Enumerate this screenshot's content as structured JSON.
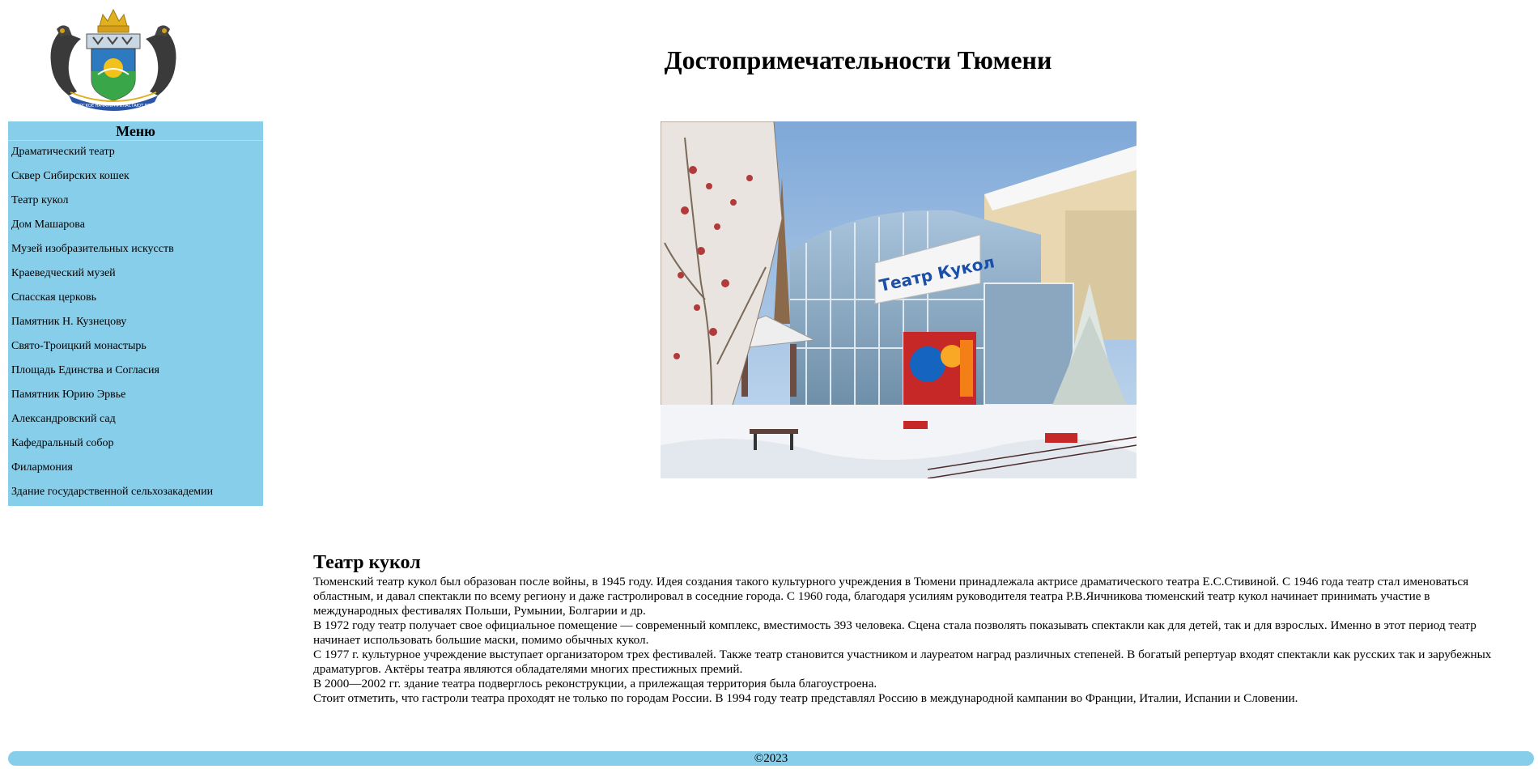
{
  "header": {
    "title": "Достопримечательности Тюмени",
    "logo_icon": "tyumen-coat-of-arms-icon",
    "logo_ribbon_text": "СИБИРСКОЕ НАЧАЛО ПРИЛАСТАЮТ ВЕДЕТ"
  },
  "sidebar": {
    "title": "Меню",
    "background": "#87ceeb",
    "items": [
      {
        "label": "Драматический театр"
      },
      {
        "label": "Сквер Сибирских кошек"
      },
      {
        "label": "Театр кукол"
      },
      {
        "label": "Дом Машарова"
      },
      {
        "label": "Музей изобразительных искусств"
      },
      {
        "label": "Краеведческий музей"
      },
      {
        "label": "Спасская церковь"
      },
      {
        "label": "Памятник Н. Кузнецову"
      },
      {
        "label": "Свято-Троицкий монастырь"
      },
      {
        "label": "Площадь Единства и Согласия"
      },
      {
        "label": "Памятник Юрию Эрвье"
      },
      {
        "label": "Александровский сад"
      },
      {
        "label": "Кафедральный собор"
      },
      {
        "label": "Филармония"
      },
      {
        "label": "Здание государственной сельхозакадемии"
      }
    ]
  },
  "main": {
    "image_sign": "Театр Кукол",
    "article": {
      "title": "Театр кукол",
      "paragraphs": [
        "Тюменский театр кукол был образован после войны, в 1945 году. Идея создания такого культурного учреждения в Тюмени принадлежала актрисе драматического театра Е.С.Стивиной. С 1946 года театр стал именоваться областным, и давал спектакли по всему региону и даже гастролировал в соседние города. С 1960 года, благодаря усилиям руководителя театра Р.В.Яичникова тюменский театр кукол начинает принимать участие в международных фестивалях Польши, Румынии, Болгарии и др.",
        "В 1972 году театр получает свое официальное помещение — современный комплекс, вместимость 393 человека. Сцена стала позволять показывать спектакли как для детей, так и для взрослых. Именно в этот период театр начинает использовать большие маски, помимо обычных кукол.",
        "С 1977 г. культурное учреждение выступает организатором трех фестивалей. Также театр становится участником и лауреатом наград различных степеней. В богатый репертуар входят спектакли как русских так и зарубежных драматургов. Актёры театра являются обладателями многих престижных премий.",
        "В 2000—2002 гг. здание театра подверглось реконструкции, а прилежащая территория была благоустроена.",
        "Стоит отметить, что гастроли театра проходят не только по городам России. В 1994 году театр представлял Россию в международной кампании во Франции, Италии, Испании и Словении."
      ]
    }
  },
  "footer": {
    "text": "©2023"
  }
}
